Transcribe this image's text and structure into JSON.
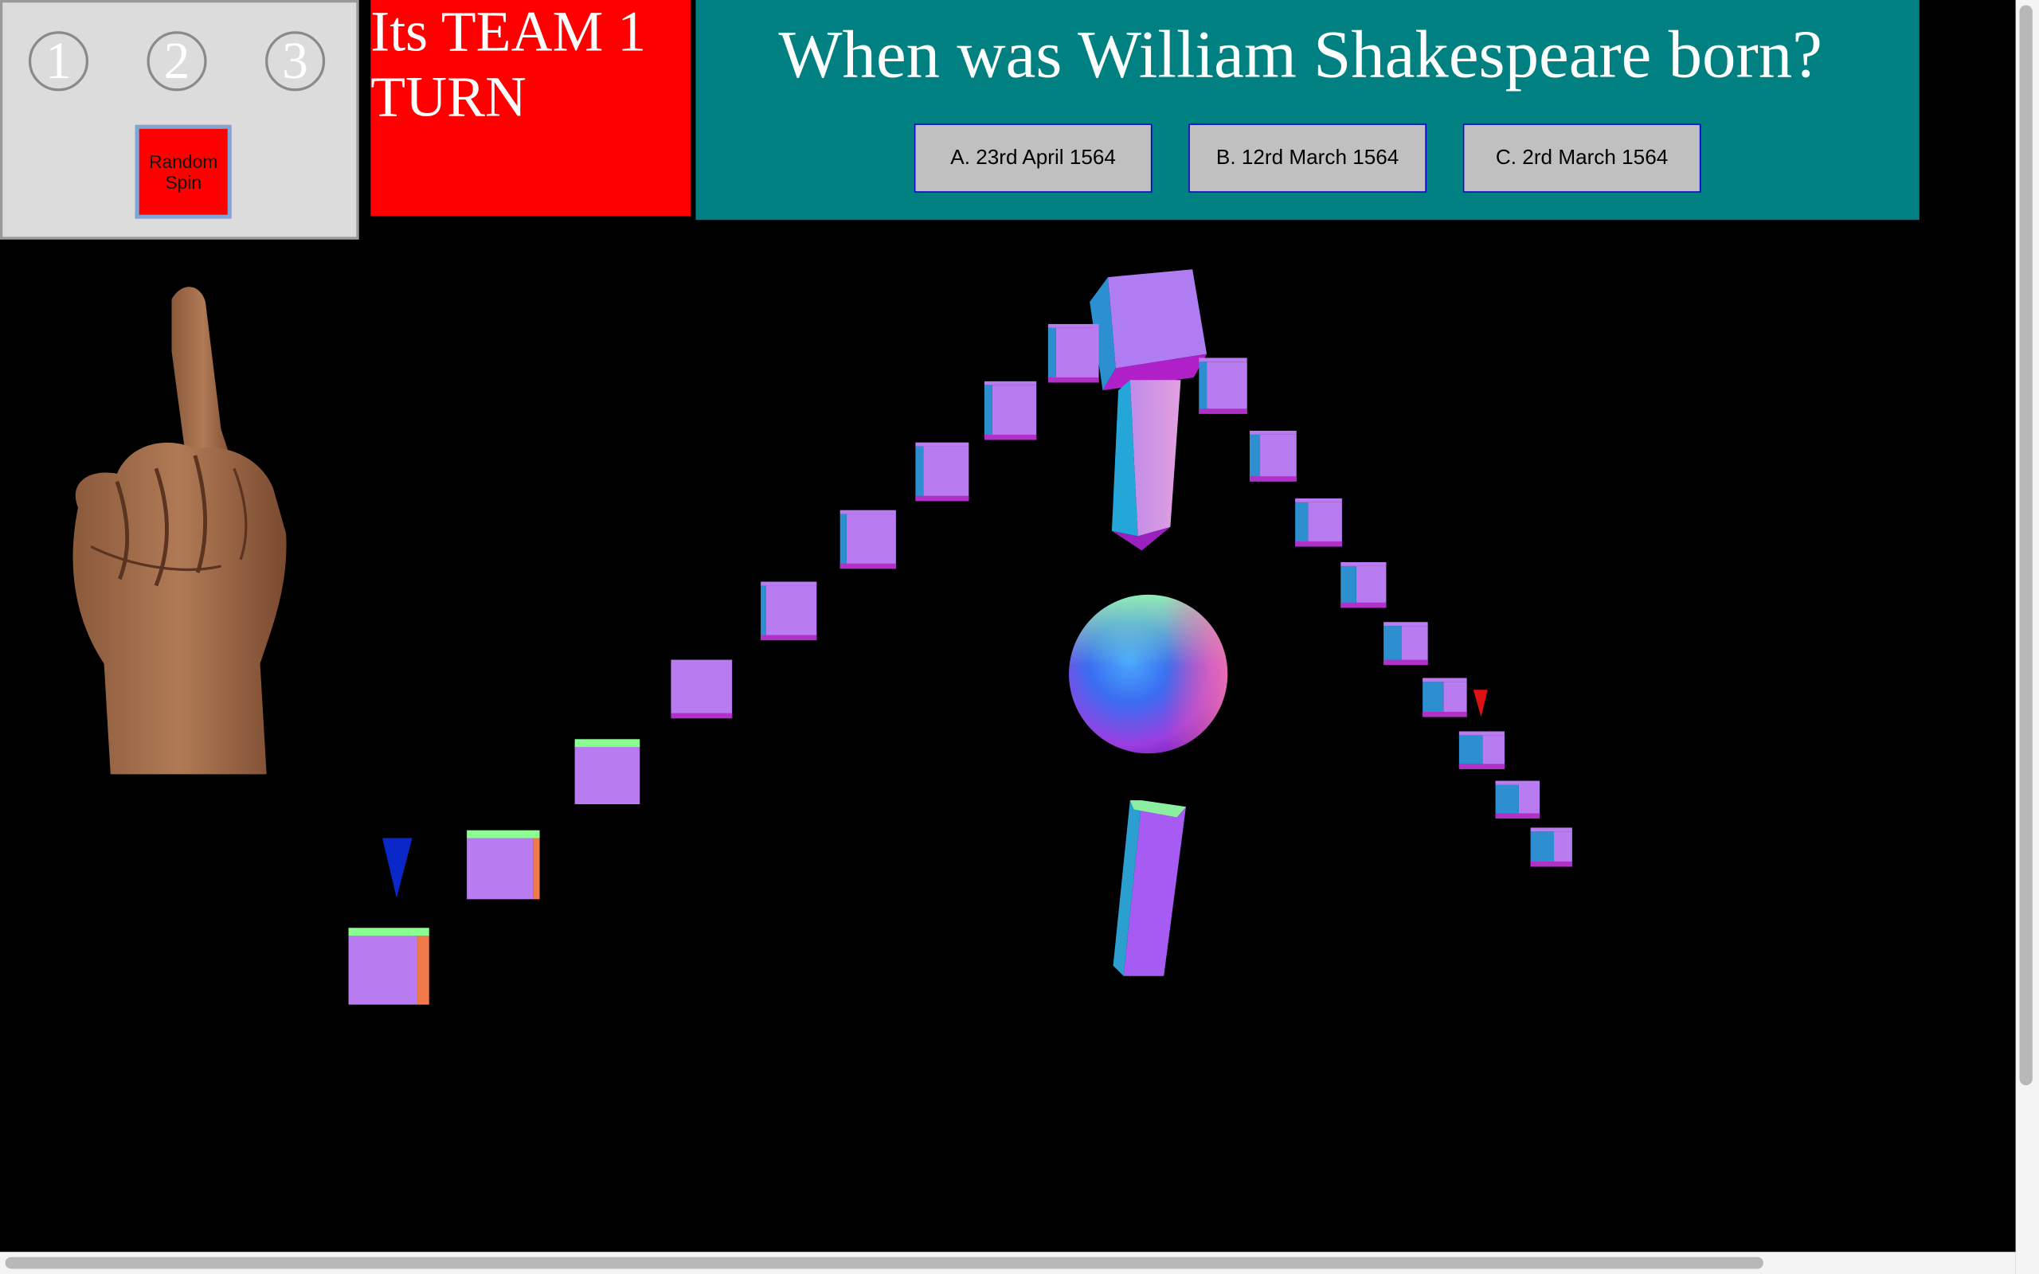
{
  "controls": {
    "spin_options": [
      "1",
      "2",
      "3"
    ],
    "random_spin_label": "Random Spin"
  },
  "turn": {
    "text": "Its TEAM 1 TURN",
    "color": "#ff0000"
  },
  "question": {
    "text": "When was William Shakespeare born?",
    "answers": [
      "A. 23rd April 1564",
      "B. 12rd March 1564",
      "C. 2rd March 1564"
    ],
    "panel_color": "#008080"
  },
  "scene": {
    "background": "#000000",
    "hand_icon": "index-finger-up-hand",
    "markers": [
      {
        "name": "team-1-marker",
        "color": "#0022cc"
      },
      {
        "name": "team-2-marker",
        "color": "#dd1111"
      }
    ],
    "colors": {
      "cube_front": "#b97cf0",
      "cube_side": "#2e8fd0",
      "cube_top_green": "#8aff90",
      "cube_bottom": "#b030c8"
    }
  }
}
